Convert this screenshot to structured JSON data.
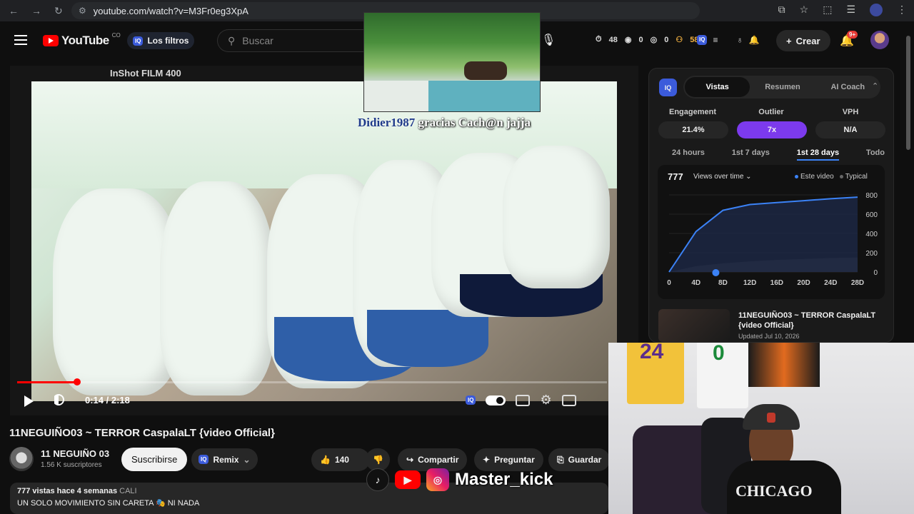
{
  "browser": {
    "url": "youtube.com/watch?v=M3Fr0eg3XpA"
  },
  "header": {
    "logo_text": "YouTube",
    "country": "CO",
    "filters_label": "Los filtros",
    "search_placeholder": "Buscar",
    "stats": {
      "views": "48",
      "eye1": "0",
      "eye2": "0",
      "people": "580"
    },
    "create_label": "Crear",
    "notifications": "9+"
  },
  "player": {
    "film_label": "InShot FILM 400",
    "time": "0:14 / 2:18",
    "progress_fraction": 0.1
  },
  "overlay": {
    "chat_user": "Didier1987",
    "chat_message": "gracias Cach@n jajja",
    "social_handle": "Master_kick"
  },
  "video": {
    "title": "11NEGUIÑO03 ~ TERROR CaspalaLT {video Official}",
    "channel_name": "11 NEGUIÑO 03",
    "subscribers": "1.56 K suscriptores",
    "subscribe_label": "Suscribirse",
    "remix_label": "Remix",
    "likes": "140",
    "share_label": "Compartir",
    "ask_label": "Preguntar",
    "save_label": "Guardar",
    "desc_views": "777 vistas",
    "desc_age": "hace 4 semanas",
    "desc_location": "CALI",
    "desc_line2": "UN SOLO MOVIMIENTO SIN CARETA 🎭 NI NADA"
  },
  "panel": {
    "tabs": [
      "Vistas",
      "Resumen",
      "AI Coach"
    ],
    "metrics": [
      {
        "label": "Engagement",
        "value": "21.4%"
      },
      {
        "label": "Outlier",
        "value": "7x"
      },
      {
        "label": "VPH",
        "value": "N/A"
      }
    ],
    "ranges": [
      "24 hours",
      "1st 7 days",
      "1st 28 days",
      "Todo"
    ],
    "chart_total": "777",
    "chart_select": "Views over time",
    "legend_this": "Este video",
    "legend_typical": "Typical",
    "related_title": "11NEGUIÑO03 ~ TERROR CaspalaLT {video Official}",
    "related_date": "Updated Jul 10, 2026"
  },
  "webcam": {
    "jersey1": "24",
    "jersey2": "0",
    "shirt_text": "CHICAGO"
  },
  "colors": {
    "accent_blue": "#3b82f6",
    "outlier_purple": "#7c3aed",
    "youtube_red": "#ff0000"
  },
  "chart_data": {
    "type": "line",
    "x": [
      "0",
      "4D",
      "8D",
      "12D",
      "16D",
      "20D",
      "24D",
      "28D"
    ],
    "ylim": [
      0,
      800
    ],
    "yticks": [
      0,
      200,
      400,
      600,
      800
    ],
    "series": [
      {
        "name": "Este video",
        "values": [
          0,
          420,
          640,
          700,
          720,
          740,
          760,
          777
        ]
      },
      {
        "name": "Typical",
        "values": [
          0,
          60,
          90,
          110,
          125,
          135,
          145,
          150
        ]
      }
    ]
  }
}
